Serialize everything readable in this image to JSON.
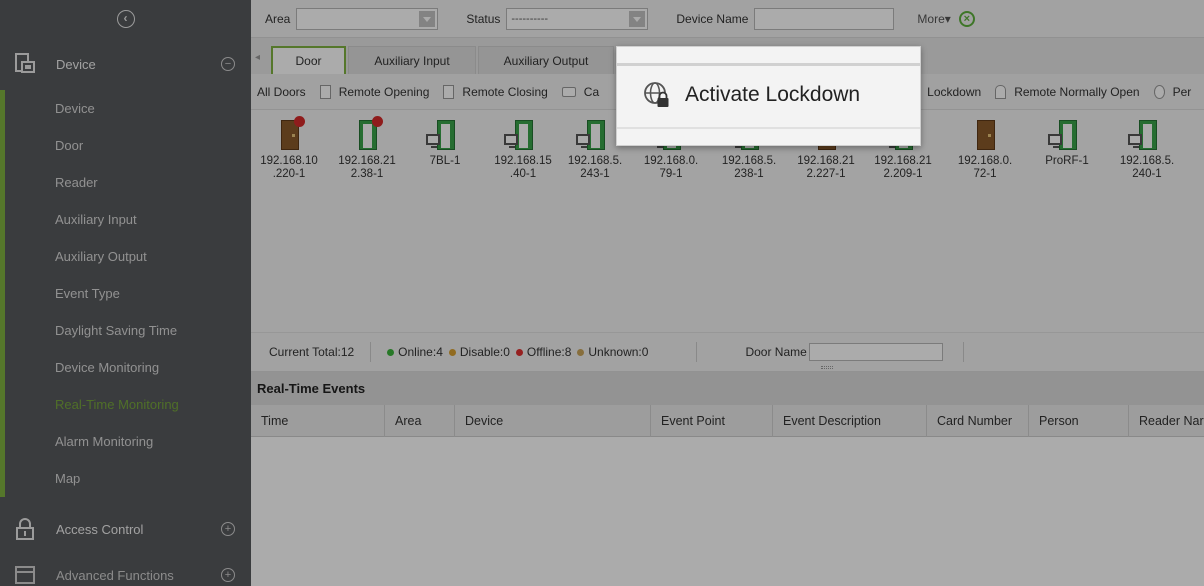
{
  "sidebar": {
    "groups": {
      "device": {
        "label": "Device"
      },
      "access_control": {
        "label": "Access Control"
      },
      "advanced": {
        "label": "Advanced Functions"
      }
    },
    "items": [
      {
        "label": "Device",
        "active": false
      },
      {
        "label": "Door",
        "active": false
      },
      {
        "label": "Reader",
        "active": false
      },
      {
        "label": "Auxiliary Input",
        "active": false
      },
      {
        "label": "Auxiliary Output",
        "active": false
      },
      {
        "label": "Event Type",
        "active": false
      },
      {
        "label": "Daylight Saving Time",
        "active": false
      },
      {
        "label": "Device Monitoring",
        "active": false
      },
      {
        "label": "Real-Time Monitoring",
        "active": true
      },
      {
        "label": "Alarm Monitoring",
        "active": false
      },
      {
        "label": "Map",
        "active": false
      }
    ],
    "accent_color": "#77a63c"
  },
  "filters": {
    "area_label": "Area",
    "area_value": "",
    "status_label": "Status",
    "status_value": "----------",
    "device_name_label": "Device Name",
    "device_name_value": "",
    "more_label": "More▾"
  },
  "tabs": [
    {
      "label": "Door",
      "active": true
    },
    {
      "label": "Auxiliary Input",
      "active": false
    },
    {
      "label": "Auxiliary Output",
      "active": false
    }
  ],
  "toolbar": {
    "all_doors": "All Doors",
    "remote_opening": "Remote Opening",
    "remote_closing": "Remote Closing",
    "cancel_alarm_partial": "Ca",
    "lockdown_partial": "Lockdown",
    "remote_normally_open": "Remote Normally Open",
    "personnel_partial": "Per"
  },
  "doors": [
    {
      "line1": "192.168.10",
      "line2": ".220-1",
      "icon": "door-closed-alarm"
    },
    {
      "line1": "192.168.21",
      "line2": "2.38-1",
      "icon": "door-open-alarm"
    },
    {
      "line1": "7BL-1",
      "line2": "",
      "icon": "door-open-monitor"
    },
    {
      "line1": "192.168.15",
      "line2": ".40-1",
      "icon": "door-open-monitor"
    },
    {
      "line1": "192.168.5.",
      "line2": "243-1",
      "icon": "door-open-monitor"
    },
    {
      "line1": "192.168.0.",
      "line2": "79-1",
      "icon": "door-open-monitor"
    },
    {
      "line1": "192.168.5.",
      "line2": "238-1",
      "icon": "door-open-monitor"
    },
    {
      "line1": "192.168.21",
      "line2": "2.227-1",
      "icon": "door-closed"
    },
    {
      "line1": "192.168.21",
      "line2": "2.209-1",
      "icon": "door-open-monitor"
    },
    {
      "line1": "192.168.0.",
      "line2": "72-1",
      "icon": "door-closed"
    },
    {
      "line1": "ProRF-1",
      "line2": "",
      "icon": "door-open-monitor"
    },
    {
      "line1": "192.168.5.",
      "line2": "240-1",
      "icon": "door-open-monitor"
    }
  ],
  "status": {
    "current_total": "Current Total:12",
    "online": "Online:4",
    "disable": "Disable:0",
    "offline": "Offline:8",
    "unknown": "Unknown:0",
    "door_name_label": "Door Name",
    "colors": {
      "online": "#3bb33b",
      "disable": "#d9a030",
      "offline": "#e03030",
      "unknown": "#c9a45a"
    }
  },
  "events": {
    "title": "Real-Time Events",
    "columns": [
      "Time",
      "Area",
      "Device",
      "Event Point",
      "Event Description",
      "Card Number",
      "Person",
      "Reader Nar"
    ]
  },
  "callout": {
    "label": "Activate Lockdown",
    "icon": "globe-lock-icon"
  }
}
